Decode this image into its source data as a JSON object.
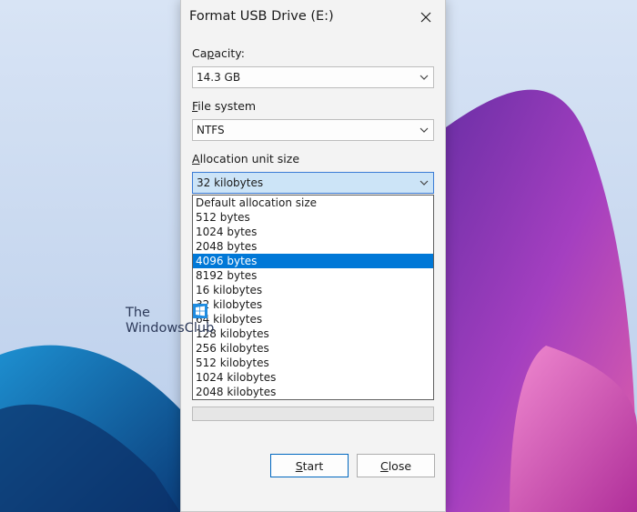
{
  "window": {
    "title": "Format USB Drive (E:)"
  },
  "capacity": {
    "label_prefix": "Ca",
    "label_accel": "p",
    "label_suffix": "acity:",
    "value": "14.3 GB"
  },
  "file_system": {
    "label_accel": "F",
    "label_suffix": "ile system",
    "value": "NTFS"
  },
  "allocation": {
    "label_accel": "A",
    "label_suffix": "llocation unit size",
    "value": "32 kilobytes",
    "options": [
      "Default allocation size",
      "512 bytes",
      "1024 bytes",
      "2048 bytes",
      "4096 bytes",
      "8192 bytes",
      "16 kilobytes",
      "32 kilobytes",
      "64 kilobytes",
      "128 kilobytes",
      "256 kilobytes",
      "512 kilobytes",
      "1024 kilobytes",
      "2048 kilobytes"
    ],
    "highlighted": "4096 bytes"
  },
  "buttons": {
    "start_accel": "S",
    "start_rest": "tart",
    "close_accel": "C",
    "close_rest": "lose"
  },
  "watermark": {
    "line1": "The",
    "line2": "WindowsClub"
  },
  "colors": {
    "accent": "#0078d7",
    "dialog_bg": "#f3f3f3",
    "wallpaper_sky": "#c9daf2",
    "wallpaper_purple": "#8e2fb0",
    "wallpaper_blue": "#1565a8"
  }
}
